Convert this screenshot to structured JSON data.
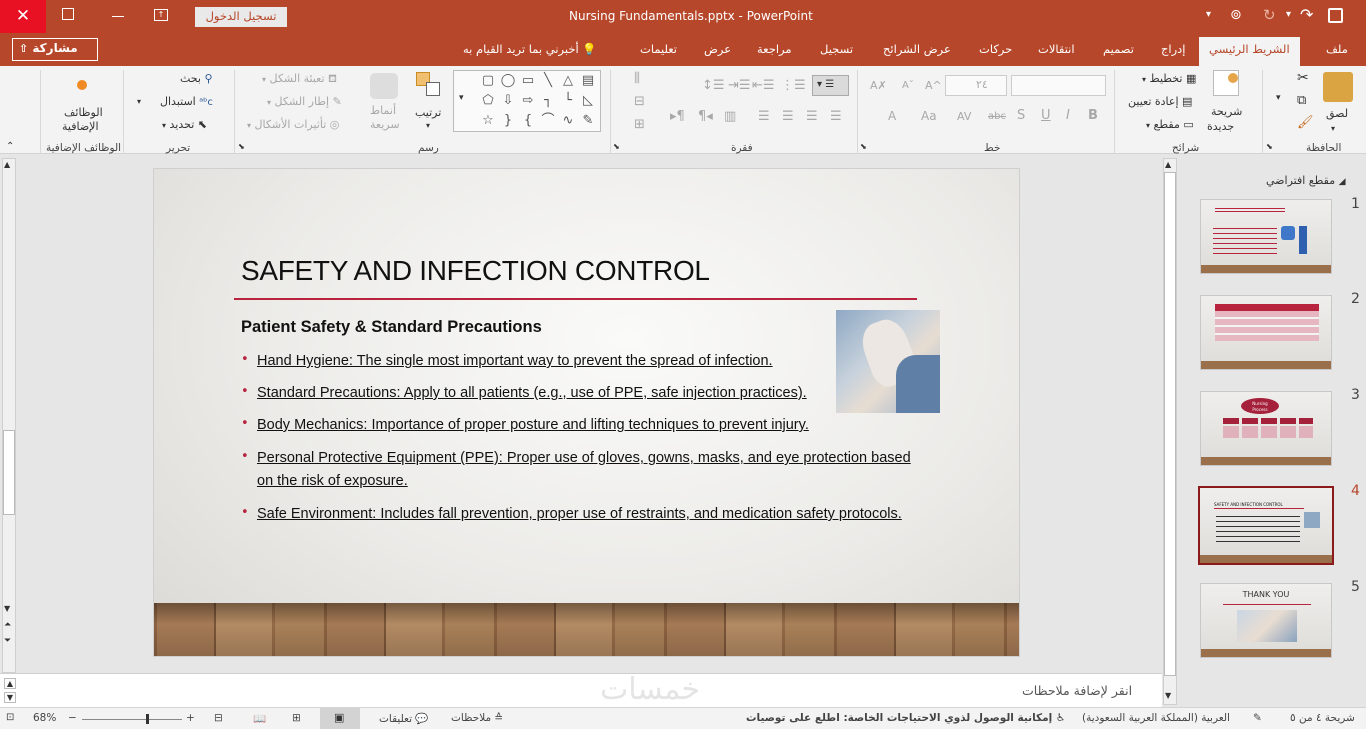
{
  "titlebar": {
    "title": "Nursing Fundamentals.pptx  -  PowerPoint",
    "signin": "تسجيل الدخول"
  },
  "tabs": {
    "file": "ملف",
    "home": "الشريط الرئيسي",
    "insert": "إدراج",
    "design": "تصميم",
    "transitions": "انتقالات",
    "animations": "حركات",
    "slideshow": "عرض الشرائح",
    "record": "تسجيل",
    "review": "مراجعة",
    "view": "عرض",
    "help": "تعليمات",
    "tellme": "أخبرني بما تريد القيام به",
    "share": "مشاركة"
  },
  "ribbon": {
    "clipboard": {
      "paste": "لصق",
      "label": "الحافظة"
    },
    "slides": {
      "new_slide_1": "شريحة",
      "new_slide_2": "جديدة",
      "layout": "تخطيط",
      "reset": "إعادة تعيين",
      "section": "مقطع",
      "label": "شرائح"
    },
    "font": {
      "size": "٢٤",
      "label": "خط",
      "bold": "B",
      "italic": "I",
      "underline": "U",
      "strike": "abc",
      "aa": "Aa",
      "a": "A"
    },
    "paragraph": {
      "label": "فقرة"
    },
    "drawing": {
      "arrange": "ترتيب",
      "quick_styles_1": "أنماط",
      "quick_styles_2": "سريعة",
      "fill": "تعبئة الشكل",
      "outline": "إطار الشكل",
      "effects": "تأثيرات الأشكال",
      "label": "رسم"
    },
    "editing": {
      "find": "بحث",
      "replace": "استبدال",
      "select": "تحديد",
      "label": "تحرير"
    },
    "addins": {
      "line1": "الوظائف",
      "line2": "الإضافية",
      "label": "الوظائف الإضافية"
    }
  },
  "slide": {
    "title": "SAFETY AND INFECTION CONTROL",
    "subtitle": "Patient Safety & Standard Precautions",
    "bullets": [
      "Hand Hygiene: The single most important way to prevent the spread of infection.",
      "Standard Precautions: Apply to all patients (e.g., use of PPE, safe injection practices).",
      "Body Mechanics: Importance of proper posture and lifting techniques to prevent injury.",
      "Personal Protective Equipment (PPE): Proper use of gloves, gowns, masks, and eye protection based on the risk of exposure.",
      "Safe Environment: Includes fall prevention, proper use of restraints, and medication safety protocols."
    ]
  },
  "notes": {
    "placeholder": "انقر لإضافة ملاحظات"
  },
  "thumbnails": {
    "section": "مقطع افتراضي",
    "numbers": [
      "1",
      "2",
      "3",
      "4",
      "5"
    ],
    "t3_bubble_1": "Nursing",
    "t3_bubble_2": "Process",
    "t4_title": "SAFETY AND INFECTION CONTROL",
    "t5_title": "THANK YOU"
  },
  "statusbar": {
    "slide_info": "شريحة ٤ من ٥",
    "language": "العربية (المملكة العربية السعودية)",
    "accessibility": "إمكانية الوصول لذوي الاحتياجات الخاصة: اطلع على توصيات",
    "notes": "ملاحظات",
    "comments": "تعليقات",
    "zoom": "68%",
    "watermark": "خمسات"
  },
  "colors": {
    "accent": "#b7472a",
    "bullet": "#b8233e",
    "rule": "#b8233e"
  }
}
